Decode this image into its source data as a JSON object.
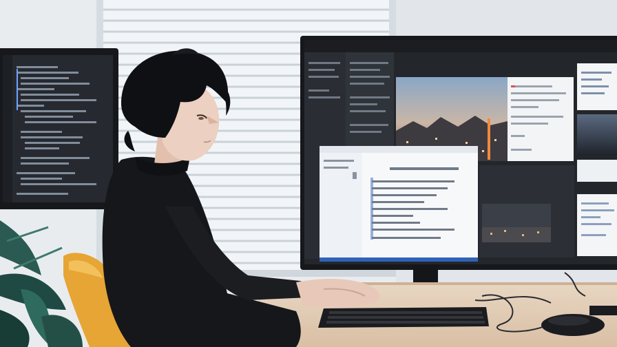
{
  "scene": {
    "palette": {
      "wall": "#eceff2",
      "blinds": "#dfe6ea",
      "monitor_bezel": "#17181b",
      "screen_dark": "#23262b",
      "screen_panel": "#2c3036",
      "doc_white": "#f7f8fa",
      "sweater": "#16171a",
      "hair": "#0f1013",
      "skin": "#e8c9b9",
      "chair": "#e6a534",
      "desk": "#e3cdb4",
      "plant": "#1e4a43",
      "accent_blue": "#2f62b8",
      "sunset_orange": "#c9703c"
    },
    "icons": [
      "monitor-left-icon",
      "monitor-right-icon",
      "keyboard-icon",
      "mouse-icon",
      "chair-icon",
      "plant-icon",
      "person-icon"
    ]
  }
}
